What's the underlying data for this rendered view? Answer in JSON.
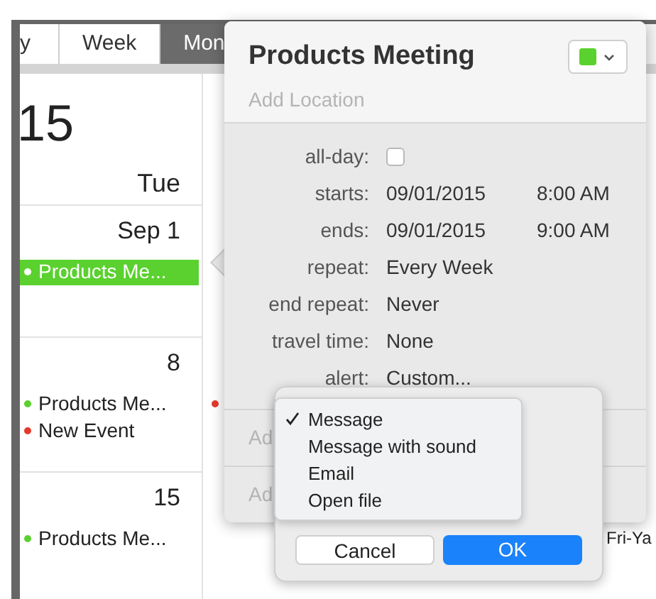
{
  "view_tabs": [
    {
      "label": "y",
      "selected": false
    },
    {
      "label": "Week",
      "selected": false
    },
    {
      "label": "Mon",
      "selected": true
    }
  ],
  "calendar": {
    "year_fragment": "15",
    "day_header": "Tue",
    "weeks": [
      {
        "date": "Sep 1",
        "events": [
          {
            "title": "Products Me...",
            "color": "#5ad12e",
            "selected": true
          }
        ]
      },
      {
        "date": "8",
        "events": [
          {
            "title": "Products Me...",
            "color": "#5ad12e",
            "selected": false
          },
          {
            "title": "New Event",
            "color": "#e5392d",
            "selected": false
          }
        ],
        "next_column_events": [
          {
            "color": "#e5392d"
          }
        ]
      },
      {
        "date": "15",
        "events": [
          {
            "title": "Products Me...",
            "color": "#5ad12e",
            "selected": false
          }
        ],
        "far_column_text": "Fri-Ya"
      }
    ]
  },
  "event_popover": {
    "title": "Products Meeting",
    "color": "#5ad12e",
    "location_placeholder": "Add Location",
    "fields": [
      {
        "kind": "checkbox",
        "label": "all-day:",
        "checked": false
      },
      {
        "kind": "datetime",
        "label": "starts:",
        "date": "09/01/2015",
        "time": "8:00 AM"
      },
      {
        "kind": "datetime",
        "label": "ends:",
        "date": "09/01/2015",
        "time": "9:00 AM"
      },
      {
        "kind": "text",
        "label": "repeat:",
        "value": "Every Week"
      },
      {
        "kind": "text",
        "label": "end repeat:",
        "value": "Never"
      },
      {
        "kind": "text",
        "label": "travel time:",
        "value": "None"
      },
      {
        "kind": "text",
        "label": "alert:",
        "value": "Custom..."
      }
    ],
    "extra_rows": [
      "Ad",
      "Ad"
    ]
  },
  "alert_dialog": {
    "menu": [
      {
        "label": "Message",
        "selected": true
      },
      {
        "label": "Message with sound",
        "selected": false
      },
      {
        "label": "Email",
        "selected": false
      },
      {
        "label": "Open file",
        "selected": false
      }
    ],
    "buttons": [
      {
        "label": "Cancel",
        "kind": "secondary"
      },
      {
        "label": "OK",
        "kind": "primary"
      }
    ]
  }
}
